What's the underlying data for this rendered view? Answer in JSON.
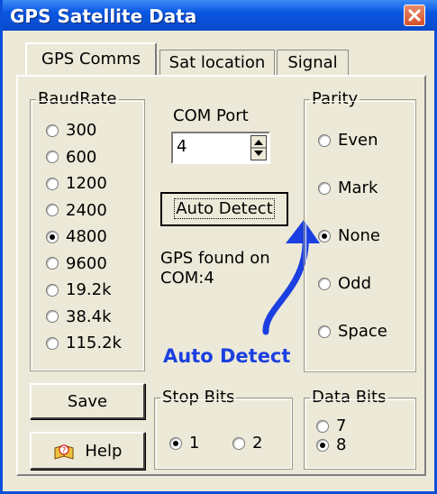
{
  "window": {
    "title": "GPS Satellite Data",
    "close_label": "close"
  },
  "tabs": [
    {
      "label": "GPS Comms",
      "active": true
    },
    {
      "label": "Sat location",
      "active": false
    },
    {
      "label": "Signal",
      "active": false
    }
  ],
  "baud": {
    "legend": "BaudRate",
    "options": [
      "300",
      "600",
      "1200",
      "2400",
      "4800",
      "9600",
      "19.2k",
      "38.4k",
      "115.2k"
    ],
    "selected": "4800"
  },
  "com": {
    "label": "COM Port",
    "value": "4"
  },
  "auto_detect": {
    "button_label": "Auto Detect",
    "status_line1": "GPS found on",
    "status_line2": "COM:4"
  },
  "parity": {
    "legend": "Parity",
    "options": [
      "Even",
      "Mark",
      "None",
      "Odd",
      "Space"
    ],
    "selected": "None"
  },
  "annotation": {
    "text": "Auto Detect",
    "color": "#1b3fe0"
  },
  "buttons": {
    "save": "Save",
    "help": "Help"
  },
  "stop_bits": {
    "legend": "Stop Bits",
    "options": [
      "1",
      "2"
    ],
    "selected": "1"
  },
  "data_bits": {
    "legend": "Data Bits",
    "options": [
      "7",
      "8"
    ],
    "selected": "8"
  },
  "icons": {
    "close": "close-icon",
    "help": "help-book-icon",
    "spin": "spin-arrows-icon"
  }
}
